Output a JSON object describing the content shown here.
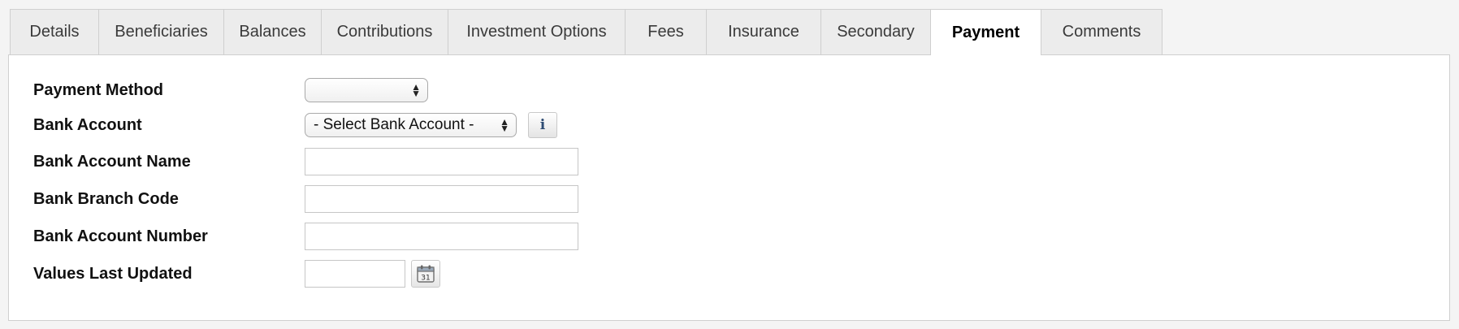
{
  "tabs": [
    {
      "label": "Details",
      "active": false
    },
    {
      "label": "Beneficiaries",
      "active": false
    },
    {
      "label": "Balances",
      "active": false
    },
    {
      "label": "Contributions",
      "active": false
    },
    {
      "label": "Investment Options",
      "active": false
    },
    {
      "label": "Fees",
      "active": false
    },
    {
      "label": "Insurance",
      "active": false
    },
    {
      "label": "Secondary",
      "active": false
    },
    {
      "label": "Payment",
      "active": true
    },
    {
      "label": "Comments",
      "active": false
    }
  ],
  "form": {
    "payment_method": {
      "label": "Payment Method",
      "value": ""
    },
    "bank_account": {
      "label": "Bank Account",
      "value": "- Select Bank Account -",
      "info_icon": "info-icon"
    },
    "bank_account_name": {
      "label": "Bank Account Name",
      "value": ""
    },
    "bank_branch_code": {
      "label": "Bank Branch Code",
      "value": ""
    },
    "bank_account_number": {
      "label": "Bank Account Number",
      "value": ""
    },
    "values_last_updated": {
      "label": "Values Last Updated",
      "value": "",
      "calendar_icon": "calendar-icon",
      "calendar_day": "31"
    }
  },
  "colors": {
    "active_tab_bg": "#ffffff",
    "inactive_tab_bg": "#ececec",
    "border": "#cfcfcf",
    "page_bg": "#f4f4f4"
  }
}
